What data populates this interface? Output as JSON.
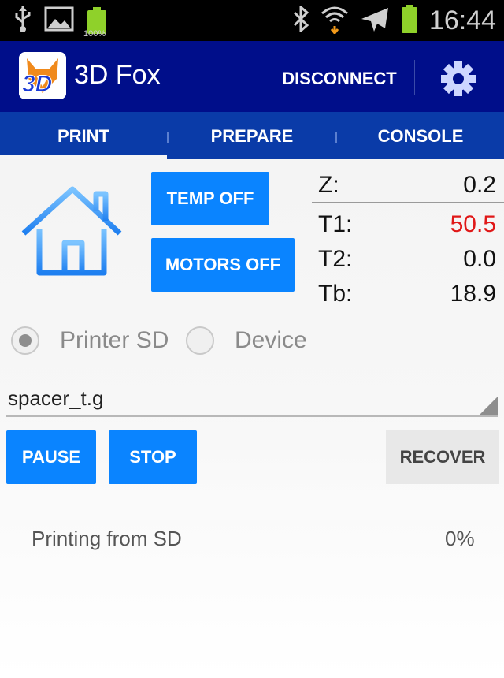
{
  "status_bar": {
    "time": "16:44",
    "battery_small_percent": "100%",
    "icons": [
      "usb-icon",
      "image-icon",
      "battery-small-icon",
      "bluetooth-icon",
      "wifi-icon",
      "airplane-icon",
      "battery-icon"
    ]
  },
  "action_bar": {
    "title": "3D Fox",
    "logo_text": "3D",
    "disconnect_label": "DISCONNECT",
    "settings_icon": "gear-icon",
    "color": "#000e8a"
  },
  "tabs": [
    {
      "label": "PRINT",
      "selected": true
    },
    {
      "label": "PREPARE",
      "selected": false
    },
    {
      "label": "CONSOLE",
      "selected": false
    }
  ],
  "controls": {
    "home_icon": "house-icon",
    "temp_off_label": "TEMP OFF",
    "motors_off_label": "MOTORS OFF"
  },
  "readouts": {
    "z": {
      "label": "Z:",
      "value": "0.2"
    },
    "t1": {
      "label": "T1:",
      "value": "50.5",
      "color": "#e01818"
    },
    "t2": {
      "label": "T2:",
      "value": "0.0"
    },
    "tb": {
      "label": "Tb:",
      "value": "18.9"
    }
  },
  "source": {
    "options": [
      {
        "label": "Printer SD",
        "checked": true
      },
      {
        "label": "Device",
        "checked": false
      }
    ]
  },
  "file_spinner": {
    "value": "spacer_t.g"
  },
  "buttons": {
    "pause": "PAUSE",
    "stop": "STOP",
    "recover": "RECOVER"
  },
  "status": {
    "text": "Printing from SD",
    "percent": "0%"
  },
  "colors": {
    "accent_button": "#0a84ff",
    "tab_bar": "#0a3ba8"
  }
}
